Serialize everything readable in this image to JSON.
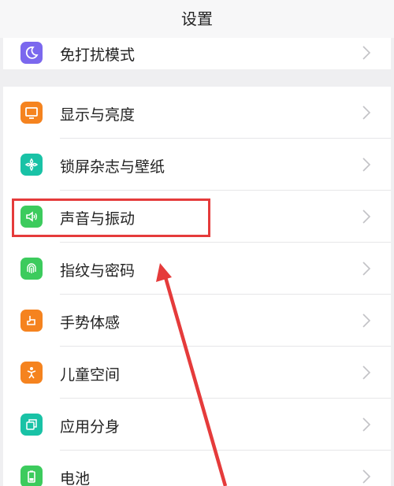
{
  "header": {
    "title": "设置"
  },
  "top_item": {
    "label": "免打扰模式",
    "icon": "moon-icon",
    "color": "#7b68ee"
  },
  "items": [
    {
      "label": "显示与亮度",
      "icon": "monitor-icon",
      "color": "#f5831f"
    },
    {
      "label": "锁屏杂志与壁纸",
      "icon": "flower-icon",
      "color": "#19c2a6"
    },
    {
      "label": "声音与振动",
      "icon": "speaker-icon",
      "color": "#3ccb5d"
    },
    {
      "label": "指纹与密码",
      "icon": "fingerprint-icon",
      "color": "#3ccb5d"
    },
    {
      "label": "手势体感",
      "icon": "hand-gesture-icon",
      "color": "#f5831f"
    },
    {
      "label": "儿童空间",
      "icon": "child-icon",
      "color": "#f5831f"
    },
    {
      "label": "应用分身",
      "icon": "app-clone-icon",
      "color": "#19c2a6"
    },
    {
      "label": "电池",
      "icon": "battery-icon",
      "color": "#3ccb5d"
    }
  ],
  "annotation": {
    "highlight_color": "#e53b3b",
    "highlighted_item": "声音与振动"
  }
}
